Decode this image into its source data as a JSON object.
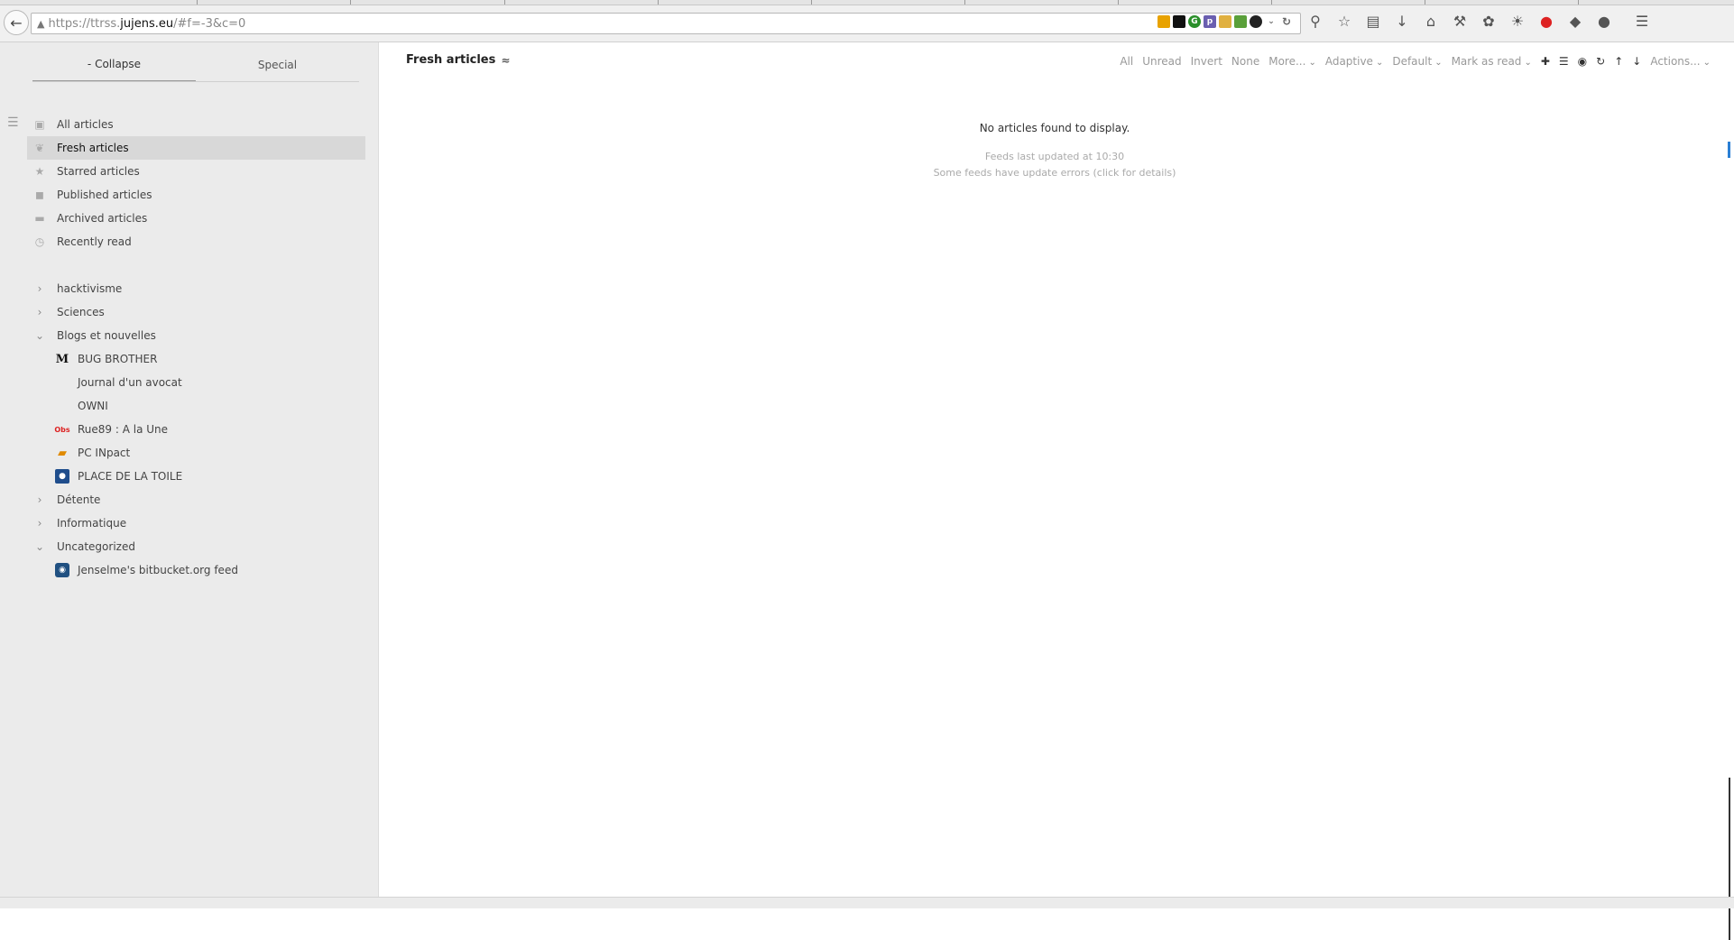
{
  "browser": {
    "url_prefix": "https://ttrss.",
    "url_domain": "jujens.eu",
    "url_rest": "/#f=-3&c=0"
  },
  "sidebar": {
    "tabs": [
      {
        "label": "- Collapse"
      },
      {
        "label": "Special"
      }
    ],
    "special": [
      {
        "label": "All articles",
        "icon": "inbox-icon"
      },
      {
        "label": "Fresh articles",
        "icon": "leaf-icon",
        "selected": true
      },
      {
        "label": "Starred articles",
        "icon": "star-icon"
      },
      {
        "label": "Published articles",
        "icon": "rss-icon"
      },
      {
        "label": "Archived articles",
        "icon": "archive-icon"
      },
      {
        "label": "Recently read",
        "icon": "clock-icon"
      }
    ],
    "categories": [
      {
        "label": "hacktivisme",
        "expanded": false
      },
      {
        "label": "Sciences",
        "expanded": false
      },
      {
        "label": "Blogs et nouvelles",
        "expanded": true
      }
    ],
    "feeds_blogs": [
      {
        "label": "BUG BROTHER",
        "favicon": "lemonde-favicon"
      },
      {
        "label": "Journal d'un avocat",
        "favicon": ""
      },
      {
        "label": "OWNI",
        "favicon": ""
      },
      {
        "label": "Rue89 : A la Une",
        "favicon": "rue89-favicon"
      },
      {
        "label": "PC INpact",
        "favicon": "pcinpact-favicon"
      },
      {
        "label": "PLACE DE LA TOILE",
        "favicon": "franceculture-favicon"
      }
    ],
    "categories2": [
      {
        "label": "Détente",
        "expanded": false
      },
      {
        "label": "Informatique",
        "expanded": false
      },
      {
        "label": "Uncategorized",
        "expanded": true
      }
    ],
    "feeds_uncat": [
      {
        "label": "Jenselme's bitbucket.org feed",
        "favicon": "bitbucket-favicon"
      }
    ]
  },
  "main": {
    "title": "Fresh articles",
    "filters": {
      "all": "All",
      "unread": "Unread",
      "invert": "Invert",
      "none": "None",
      "more": "More...",
      "adaptive": "Adaptive",
      "default": "Default",
      "mark_as_read": "Mark as read",
      "actions": "Actions..."
    },
    "empty_message": "No articles found to display.",
    "updated_line1": "Feeds last updated at 10:30",
    "updated_line2": "Some feeds have update errors (click for details)"
  }
}
